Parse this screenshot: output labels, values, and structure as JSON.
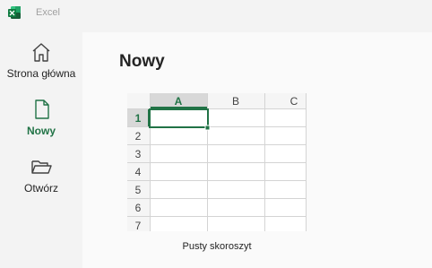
{
  "app": {
    "title": "Excel",
    "icon": "excel-logo-icon",
    "accent": "#217346"
  },
  "nav": {
    "items": [
      {
        "label": "Strona główna",
        "icon": "home-icon",
        "active": false
      },
      {
        "label": "Nowy",
        "icon": "new-document-icon",
        "active": true
      },
      {
        "label": "Otwórz",
        "icon": "folder-open-icon",
        "active": false
      }
    ]
  },
  "main": {
    "title": "Nowy",
    "templates": [
      {
        "label": "Pusty skoroszyt",
        "columns": [
          "A",
          "B",
          "C"
        ],
        "rows": [
          "1",
          "2",
          "3",
          "4",
          "5",
          "6",
          "7"
        ],
        "selected_cell": "A1"
      }
    ]
  }
}
